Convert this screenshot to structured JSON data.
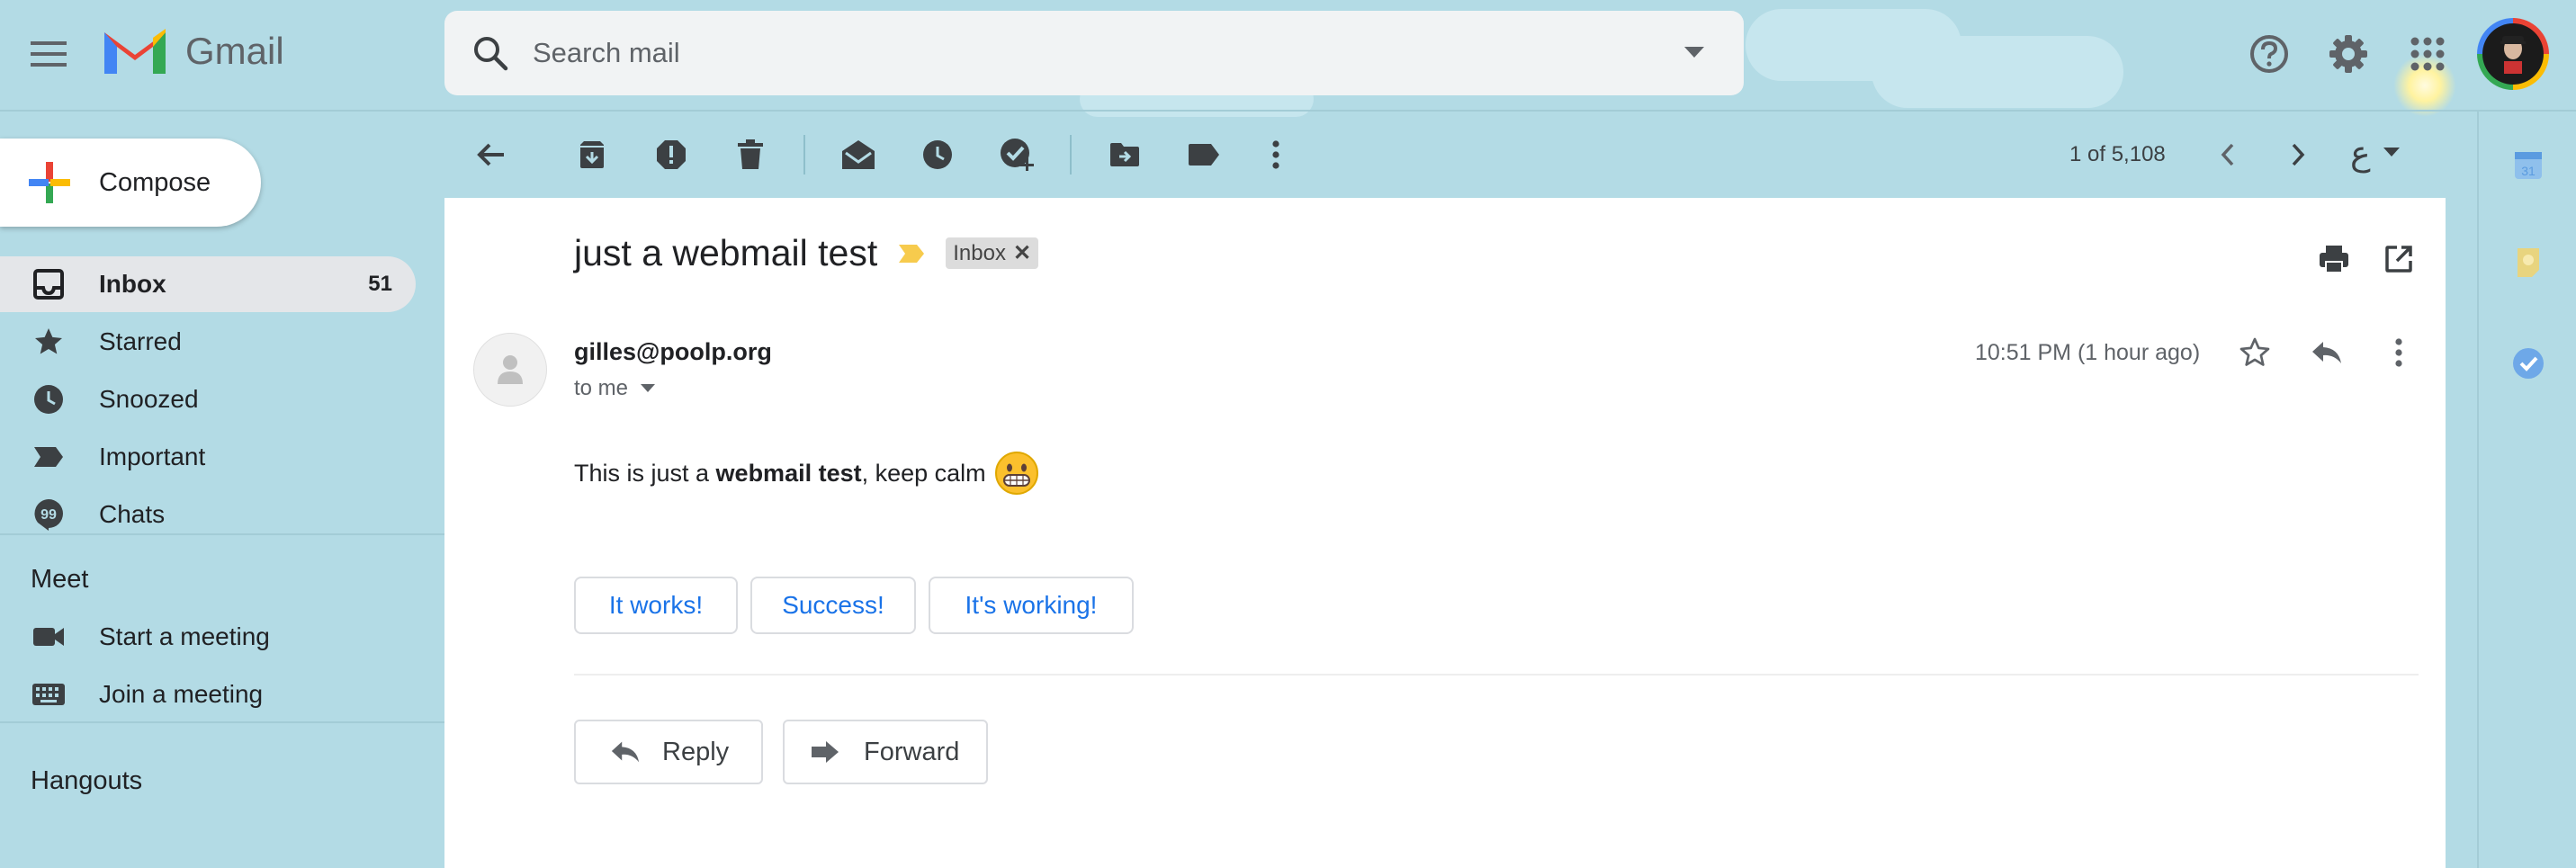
{
  "app": {
    "name": "Gmail"
  },
  "search": {
    "placeholder": "Search mail"
  },
  "sidebar": {
    "compose_label": "Compose",
    "items": [
      {
        "label": "Inbox",
        "count": "51",
        "icon": "inbox-icon",
        "active": true
      },
      {
        "label": "Starred",
        "icon": "star-icon"
      },
      {
        "label": "Snoozed",
        "icon": "clock-icon"
      },
      {
        "label": "Important",
        "icon": "important-icon"
      },
      {
        "label": "Chats",
        "icon": "chat-icon"
      }
    ],
    "meet": {
      "title": "Meet",
      "items": [
        {
          "label": "Start a meeting",
          "icon": "video-camera-icon"
        },
        {
          "label": "Join a meeting",
          "icon": "keyboard-icon"
        }
      ]
    },
    "hangouts_title": "Hangouts"
  },
  "toolbar": {
    "pagination": "1 of 5,108",
    "input_tool": "ع"
  },
  "message": {
    "subject": "just a webmail test",
    "label_chip": "Inbox",
    "sender": "gilles@poolp.org",
    "recipient": "to me",
    "timestamp": "10:51 PM (1 hour ago)",
    "body_prefix": "This is just a ",
    "body_bold": "webmail test",
    "body_suffix": ", keep calm",
    "smart_replies": [
      "It works!",
      "Success!",
      "It's working!"
    ],
    "reply_label": "Reply",
    "forward_label": "Forward"
  },
  "colors": {
    "background": "#b3dbe5",
    "accent_blue": "#1a73e8",
    "gmail_red": "#ea4335",
    "important_yellow": "#f7cb4d"
  }
}
